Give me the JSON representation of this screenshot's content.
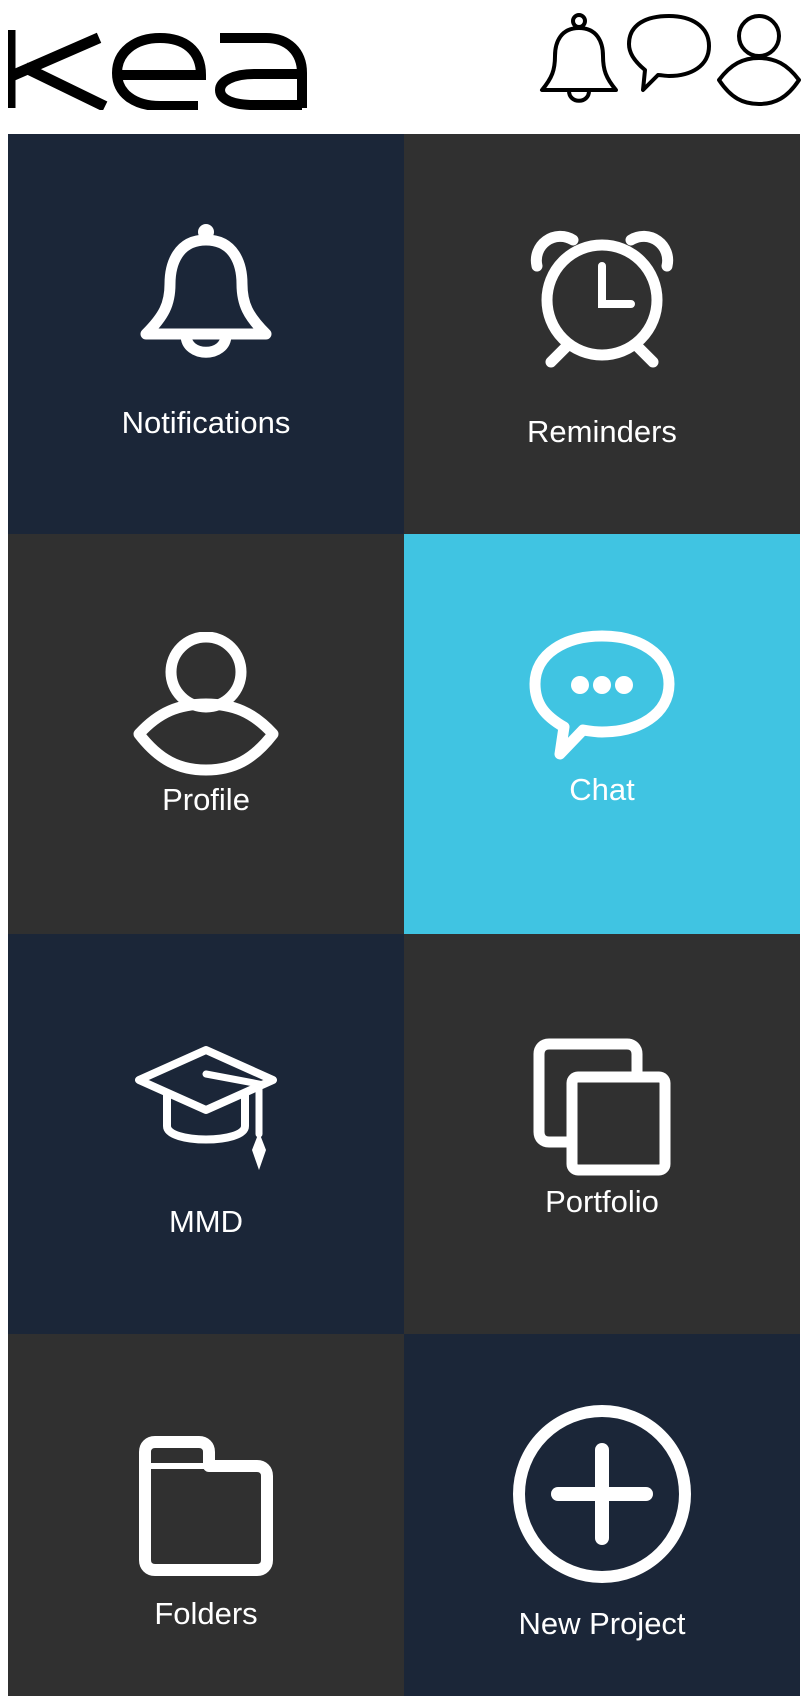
{
  "header": {
    "logo_text": "kea",
    "icons": [
      "bell-icon",
      "chat-bubble-icon",
      "user-icon"
    ]
  },
  "tiles": [
    {
      "label": "Notifications",
      "icon": "bell-icon",
      "color": "#1b2638"
    },
    {
      "label": "Reminders",
      "icon": "alarm-clock-icon",
      "color": "#303030"
    },
    {
      "label": "Profile",
      "icon": "user-icon",
      "color": "#303030"
    },
    {
      "label": "Chat",
      "icon": "chat-bubble-icon",
      "color": "#40c4e2"
    },
    {
      "label": "MMD",
      "icon": "graduation-cap-icon",
      "color": "#1b2638"
    },
    {
      "label": "Portfolio",
      "icon": "overlapping-squares-icon",
      "color": "#303030"
    },
    {
      "label": "Folders",
      "icon": "folder-icon",
      "color": "#303030"
    },
    {
      "label": "New Project",
      "icon": "plus-circle-icon",
      "color": "#1b2638"
    }
  ],
  "colors": {
    "navy": "#1b2638",
    "charcoal": "#303030",
    "cyan": "#40c4e2",
    "header_background": "#ffffff"
  }
}
